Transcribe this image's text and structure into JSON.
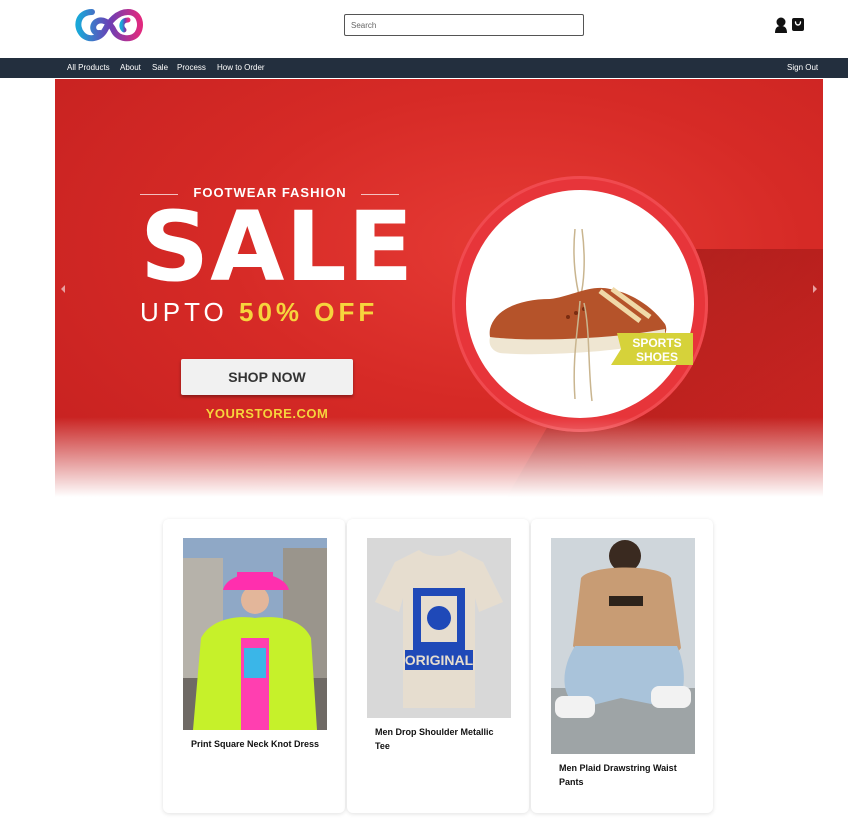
{
  "header": {
    "search_placeholder": "Search"
  },
  "nav": {
    "items": [
      "All Products",
      "About",
      "Sale",
      "Process",
      "How to Order"
    ],
    "sign_out": "Sign Out"
  },
  "banner": {
    "tagline": "FOOTWEAR FASHION",
    "headline": "SALE",
    "upto": "UPTO",
    "percent": "50% OFF",
    "button": "SHOP NOW",
    "store": "YOURSTORE.COM",
    "tag_line1": "SPORTS",
    "tag_line2": "SHOES"
  },
  "products": [
    {
      "title": "Print Square Neck Knot Dress"
    },
    {
      "title": "Men Drop Shoulder Metallic Tee",
      "print_line1": "ORIGINAL"
    },
    {
      "title": "Men Plaid Drawstring Waist Pants"
    }
  ],
  "colors": {
    "nav_bg": "#232f3e",
    "banner_red": "#d62a26",
    "accent_yellow": "#f6d43d"
  }
}
